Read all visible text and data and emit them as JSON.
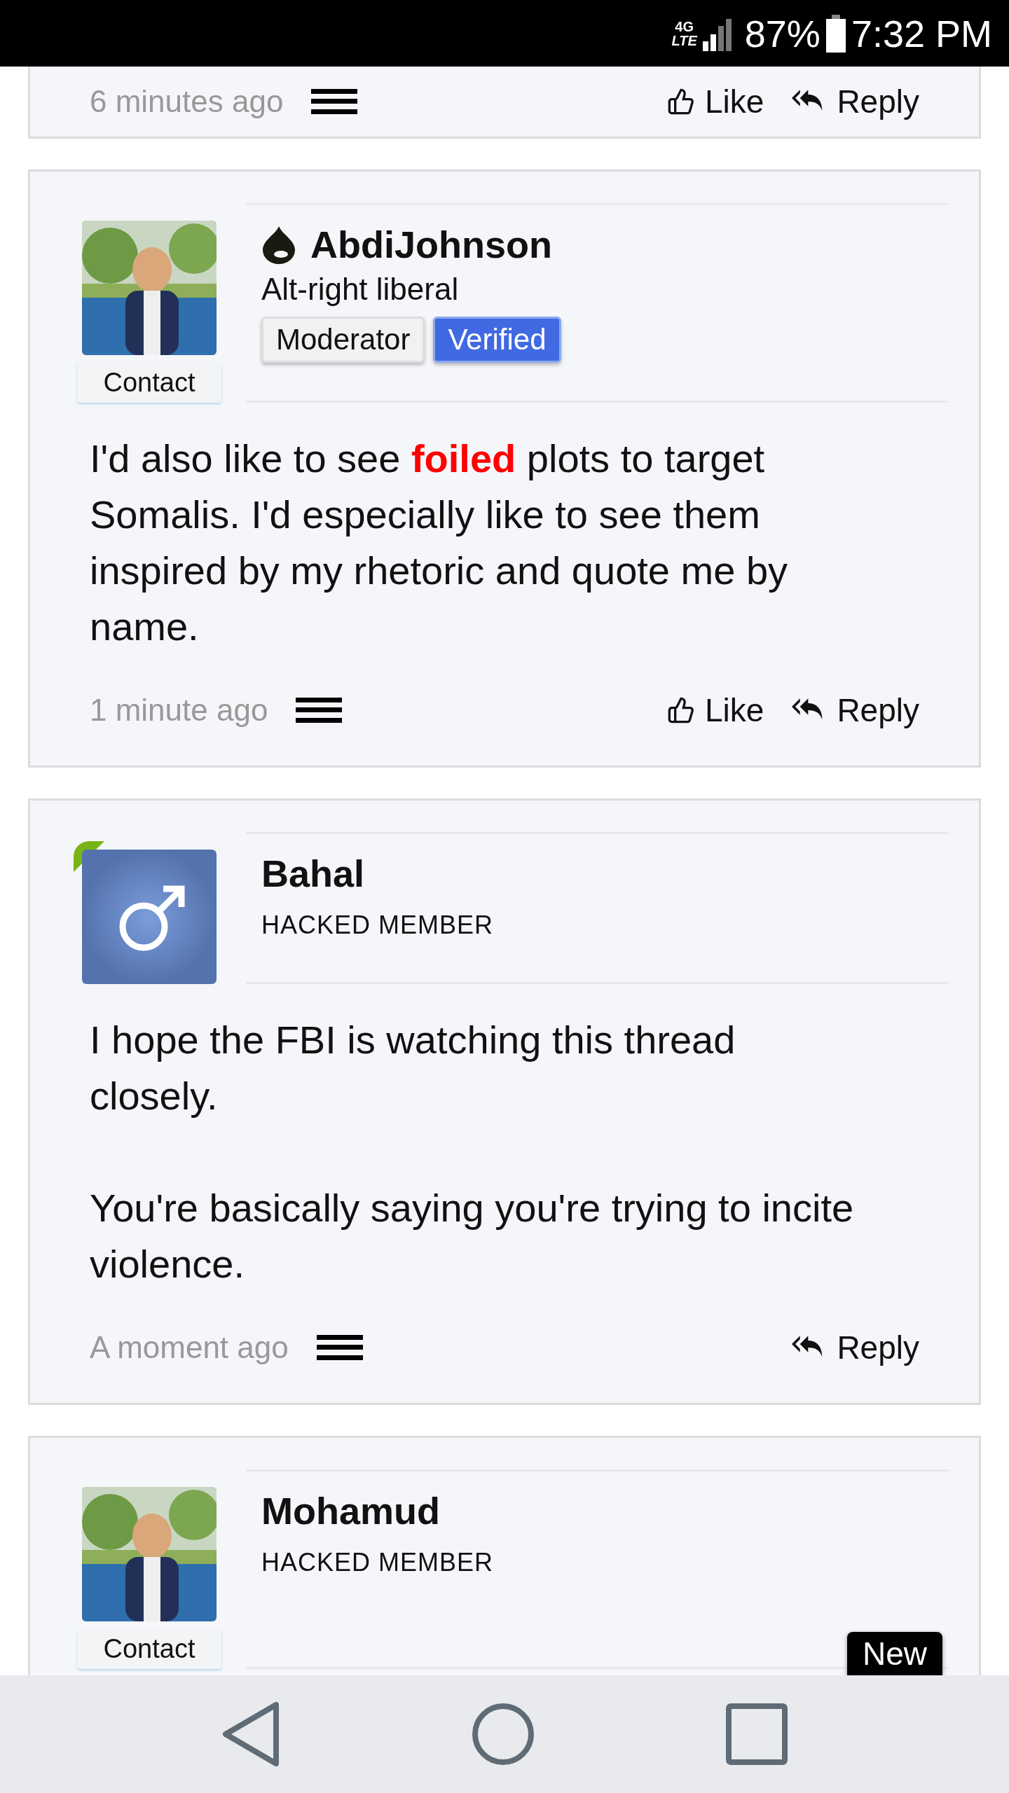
{
  "status_bar": {
    "network": "4G",
    "network_sub": "LTE",
    "battery": "87%",
    "time": "7:32 PM"
  },
  "posts": [
    {
      "kind": "partial",
      "time": "6 minutes ago",
      "actions": [
        {
          "kind": "like",
          "label": "Like"
        },
        {
          "kind": "reply",
          "label": "Reply"
        }
      ]
    },
    {
      "kind": "full",
      "avatar": {
        "kind": "picture",
        "online": false
      },
      "contact": "Contact",
      "name": "AbdiJohnson",
      "name_icon": true,
      "title": "Alt-right liberal",
      "roles": [
        {
          "label": "Moderator",
          "kind": "plain"
        },
        {
          "label": "Verified",
          "kind": "primary"
        }
      ],
      "body": [
        "I'd also like to see **foiled** plots to target Somalis. I'd especially like to see them inspired by my rhetoric and quote me by name."
      ],
      "time": "1 minute ago",
      "actions": [
        {
          "kind": "like",
          "label": "Like"
        },
        {
          "kind": "reply",
          "label": "Reply"
        }
      ]
    },
    {
      "kind": "full",
      "avatar": {
        "kind": "symbol",
        "online": true
      },
      "name": "Bahal",
      "name_icon": false,
      "rank": "HACKED MEMBER",
      "body": [
        "I hope the FBI is watching this thread closely.",
        "You're basically saying you're trying to incite violence."
      ],
      "time": "A moment ago",
      "actions": [
        {
          "kind": "reply",
          "label": "Reply"
        }
      ]
    },
    {
      "kind": "cut",
      "avatar": {
        "kind": "picture",
        "online": false
      },
      "contact": "Contact",
      "name": "Mohamud",
      "name_icon": false,
      "rank": "HACKED MEMBER",
      "new_badge": "New"
    }
  ]
}
